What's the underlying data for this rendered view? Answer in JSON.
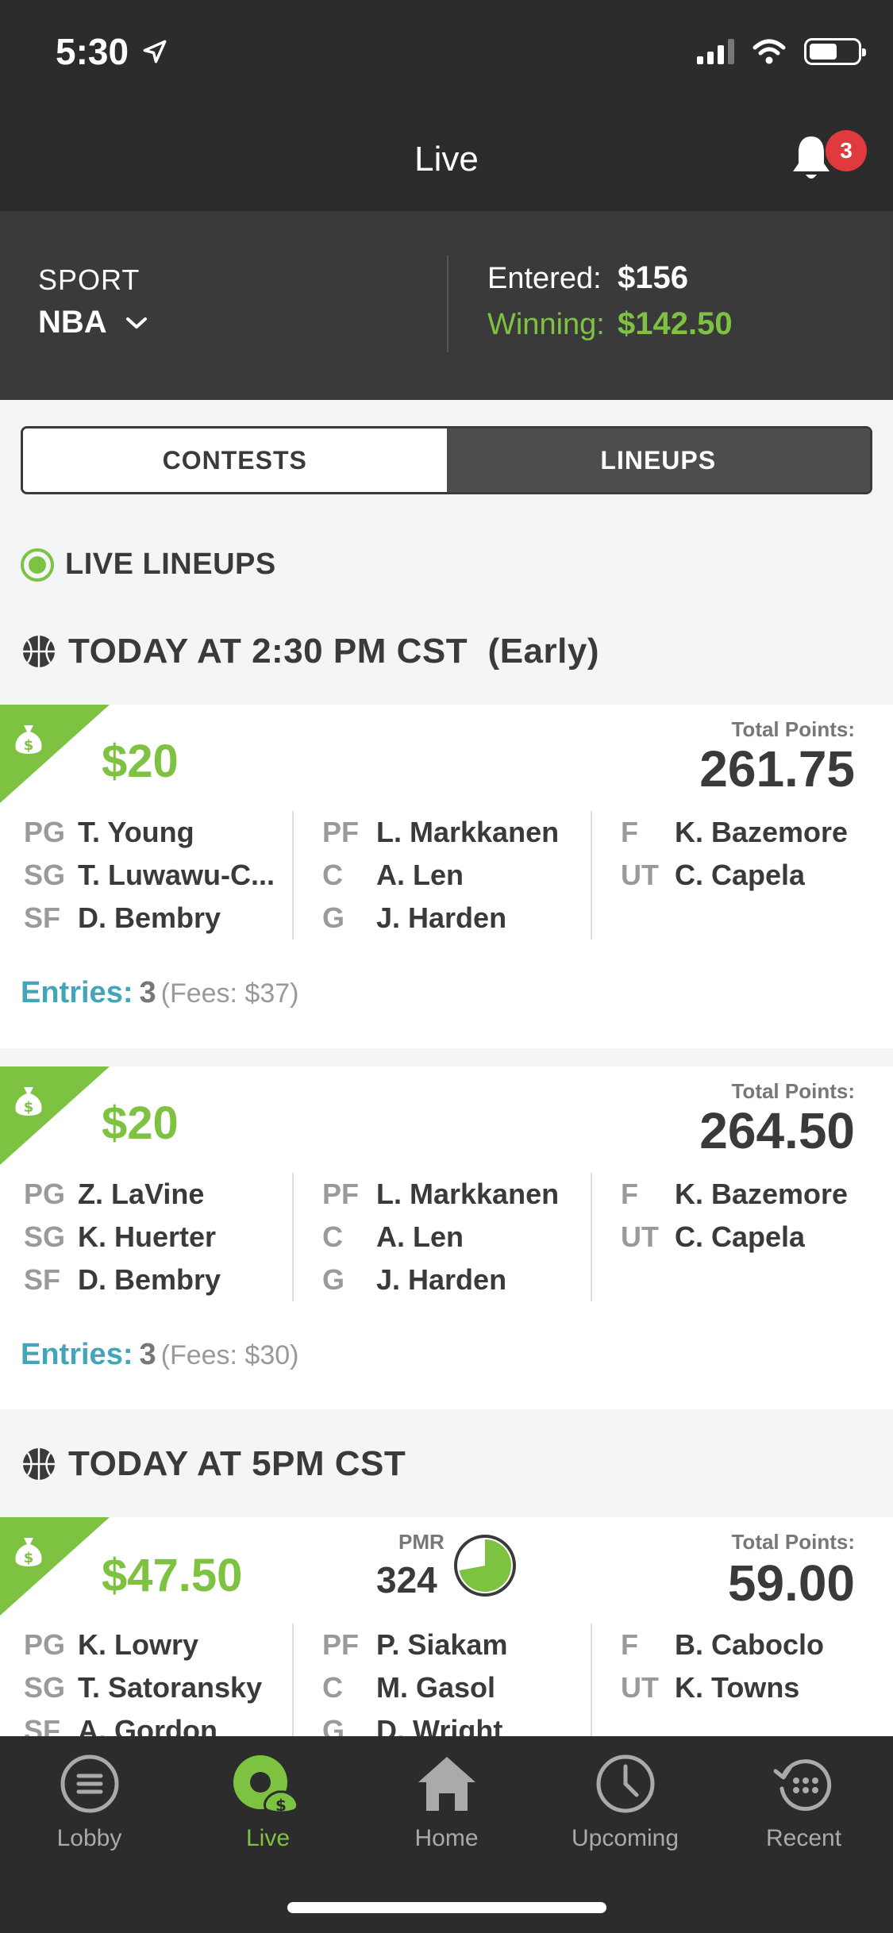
{
  "status": {
    "time": "5:30"
  },
  "header": {
    "title": "Live",
    "notification_count": "3"
  },
  "summary": {
    "sport_label": "SPORT",
    "sport_value": "NBA",
    "entered_label": "Entered:",
    "entered_value": "$156",
    "winning_label": "Winning:",
    "winning_value": "$142.50"
  },
  "segments": {
    "contests": "CONTESTS",
    "lineups": "LINEUPS",
    "active": "lineups"
  },
  "live_header": "LIVE LINEUPS",
  "groups": [
    {
      "title": "TODAY AT 2:30 PM CST  (Early)",
      "cards": [
        {
          "prize": "$20",
          "total_points_label": "Total Points:",
          "total_points": "261.75",
          "col1": [
            {
              "pos": "PG",
              "name": "T. Young"
            },
            {
              "pos": "SG",
              "name": "T. Luwawu-C..."
            },
            {
              "pos": "SF",
              "name": "D. Bembry"
            }
          ],
          "col2": [
            {
              "pos": "PF",
              "name": "L. Markkanen"
            },
            {
              "pos": "C",
              "name": "A. Len"
            },
            {
              "pos": "G",
              "name": "J. Harden"
            }
          ],
          "col3": [
            {
              "pos": "F",
              "name": "K. Bazemore"
            },
            {
              "pos": "UT",
              "name": "C. Capela"
            }
          ],
          "entries_label": "Entries:",
          "entries_count": "3",
          "fees": "(Fees: $37)"
        },
        {
          "prize": "$20",
          "total_points_label": "Total Points:",
          "total_points": "264.50",
          "col1": [
            {
              "pos": "PG",
              "name": "Z. LaVine"
            },
            {
              "pos": "SG",
              "name": "K. Huerter"
            },
            {
              "pos": "SF",
              "name": "D. Bembry"
            }
          ],
          "col2": [
            {
              "pos": "PF",
              "name": "L. Markkanen"
            },
            {
              "pos": "C",
              "name": "A. Len"
            },
            {
              "pos": "G",
              "name": "J. Harden"
            }
          ],
          "col3": [
            {
              "pos": "F",
              "name": "K. Bazemore"
            },
            {
              "pos": "UT",
              "name": "C. Capela"
            }
          ],
          "entries_label": "Entries:",
          "entries_count": "3",
          "fees": "(Fees: $30)"
        }
      ]
    },
    {
      "title": "TODAY AT 5PM CST",
      "cards": [
        {
          "prize": "$47.50",
          "pmr_label": "PMR",
          "pmr_value": "324",
          "pmr_progress": 0.72,
          "total_points_label": "Total Points:",
          "total_points": "59.00",
          "col1": [
            {
              "pos": "PG",
              "name": "K. Lowry"
            },
            {
              "pos": "SG",
              "name": "T. Satoransky"
            },
            {
              "pos": "SF",
              "name": "A. Gordon"
            }
          ],
          "col2": [
            {
              "pos": "PF",
              "name": "P. Siakam"
            },
            {
              "pos": "C",
              "name": "M. Gasol"
            },
            {
              "pos": "G",
              "name": "D. Wright"
            }
          ],
          "col3": [
            {
              "pos": "F",
              "name": "B. Caboclo"
            },
            {
              "pos": "UT",
              "name": "K. Towns"
            }
          ]
        }
      ]
    }
  ],
  "tabs": [
    {
      "label": "Lobby",
      "icon": "menu-icon"
    },
    {
      "label": "Live",
      "icon": "live-money-icon",
      "active": true
    },
    {
      "label": "Home",
      "icon": "home-icon"
    },
    {
      "label": "Upcoming",
      "icon": "clock-icon"
    },
    {
      "label": "Recent",
      "icon": "history-icon"
    }
  ],
  "colors": {
    "accent_green": "#7ec242",
    "entries_teal": "#43a6b8",
    "dark_bg": "#2c2c2c",
    "badge_red": "#e03a3e"
  }
}
